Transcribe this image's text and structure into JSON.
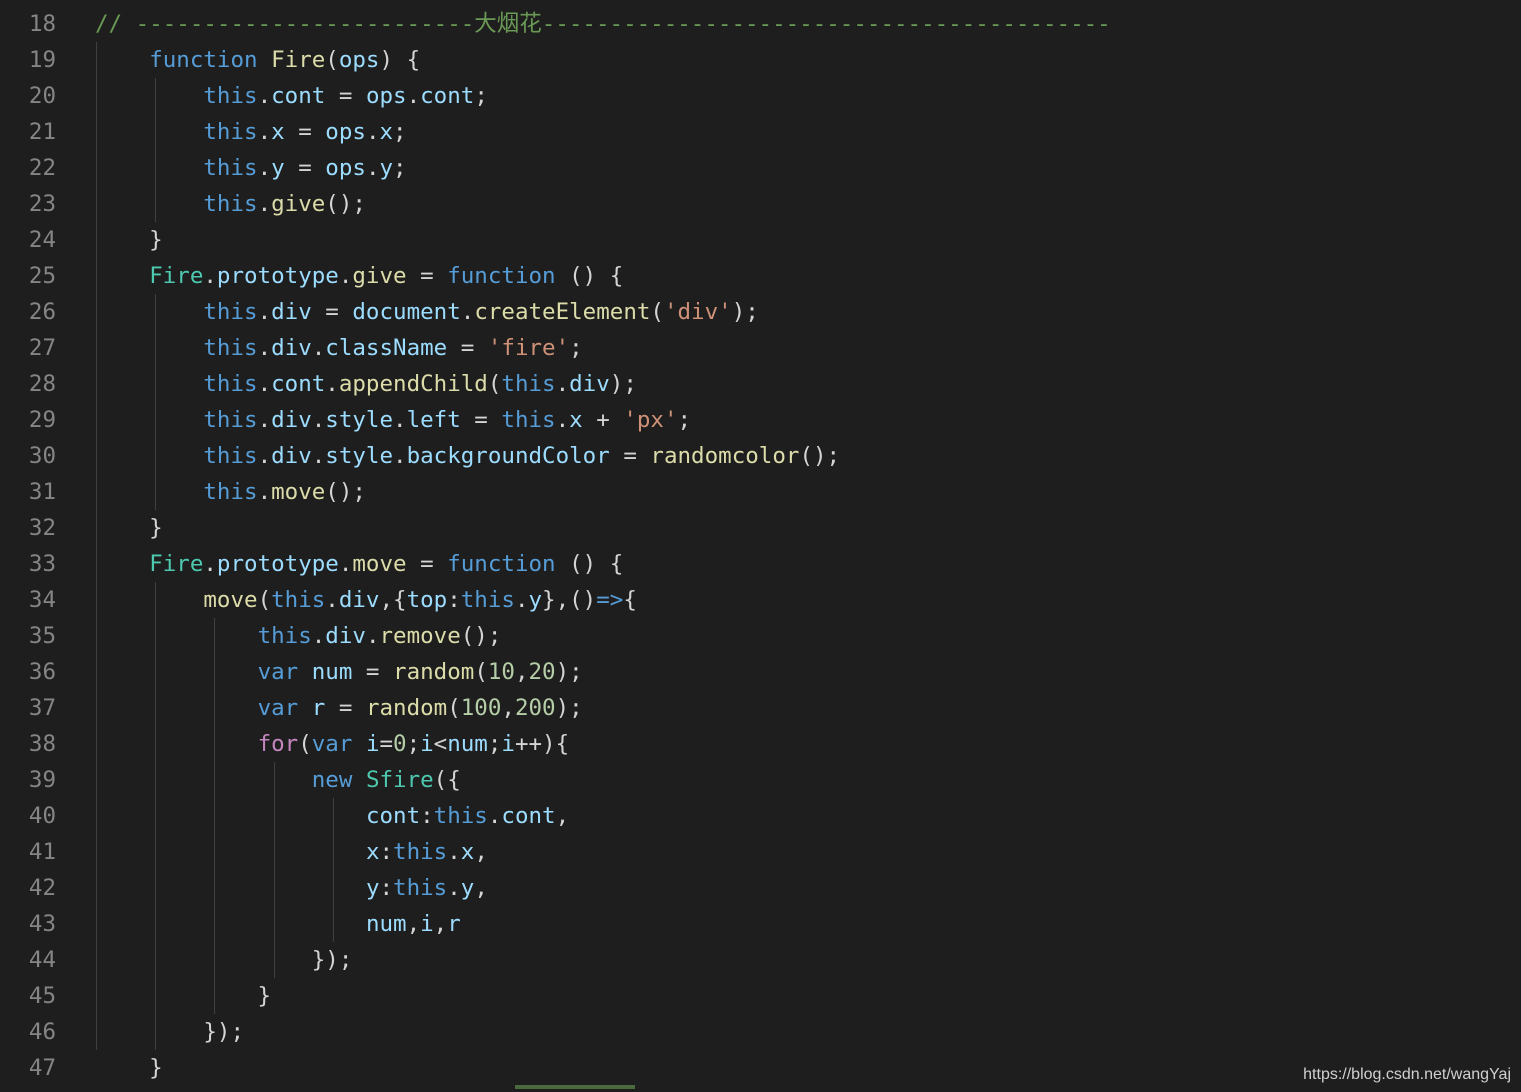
{
  "editor": {
    "watermark": "https://blog.csdn.net/wangYaj",
    "lines": [
      {
        "num": "18",
        "tokens": [
          {
            "t": "// -------------------------大烟花------------------------------------------",
            "c": "cmt"
          }
        ]
      },
      {
        "num": "19",
        "tokens": [
          {
            "t": "    "
          },
          {
            "t": "function",
            "c": "kw-blue"
          },
          {
            "t": " "
          },
          {
            "t": "Fire",
            "c": "fn"
          },
          {
            "t": "("
          },
          {
            "t": "ops",
            "c": "var"
          },
          {
            "t": ") {"
          }
        ]
      },
      {
        "num": "20",
        "tokens": [
          {
            "t": "        "
          },
          {
            "t": "this",
            "c": "kw-blue"
          },
          {
            "t": "."
          },
          {
            "t": "cont",
            "c": "var"
          },
          {
            "t": " = "
          },
          {
            "t": "ops",
            "c": "var"
          },
          {
            "t": "."
          },
          {
            "t": "cont",
            "c": "var"
          },
          {
            "t": ";"
          }
        ]
      },
      {
        "num": "21",
        "tokens": [
          {
            "t": "        "
          },
          {
            "t": "this",
            "c": "kw-blue"
          },
          {
            "t": "."
          },
          {
            "t": "x",
            "c": "var"
          },
          {
            "t": " = "
          },
          {
            "t": "ops",
            "c": "var"
          },
          {
            "t": "."
          },
          {
            "t": "x",
            "c": "var"
          },
          {
            "t": ";"
          }
        ]
      },
      {
        "num": "22",
        "tokens": [
          {
            "t": "        "
          },
          {
            "t": "this",
            "c": "kw-blue"
          },
          {
            "t": "."
          },
          {
            "t": "y",
            "c": "var"
          },
          {
            "t": " = "
          },
          {
            "t": "ops",
            "c": "var"
          },
          {
            "t": "."
          },
          {
            "t": "y",
            "c": "var"
          },
          {
            "t": ";"
          }
        ]
      },
      {
        "num": "23",
        "tokens": [
          {
            "t": "        "
          },
          {
            "t": "this",
            "c": "kw-blue"
          },
          {
            "t": "."
          },
          {
            "t": "give",
            "c": "fn"
          },
          {
            "t": "();"
          }
        ]
      },
      {
        "num": "24",
        "tokens": [
          {
            "t": "    }"
          }
        ]
      },
      {
        "num": "25",
        "tokens": [
          {
            "t": "    "
          },
          {
            "t": "Fire",
            "c": "type"
          },
          {
            "t": "."
          },
          {
            "t": "prototype",
            "c": "var"
          },
          {
            "t": "."
          },
          {
            "t": "give",
            "c": "fn"
          },
          {
            "t": " = "
          },
          {
            "t": "function",
            "c": "kw-blue"
          },
          {
            "t": " () {"
          }
        ]
      },
      {
        "num": "26",
        "tokens": [
          {
            "t": "        "
          },
          {
            "t": "this",
            "c": "kw-blue"
          },
          {
            "t": "."
          },
          {
            "t": "div",
            "c": "var"
          },
          {
            "t": " = "
          },
          {
            "t": "document",
            "c": "var"
          },
          {
            "t": "."
          },
          {
            "t": "createElement",
            "c": "fn"
          },
          {
            "t": "("
          },
          {
            "t": "'div'",
            "c": "str"
          },
          {
            "t": ");"
          }
        ]
      },
      {
        "num": "27",
        "tokens": [
          {
            "t": "        "
          },
          {
            "t": "this",
            "c": "kw-blue"
          },
          {
            "t": "."
          },
          {
            "t": "div",
            "c": "var"
          },
          {
            "t": "."
          },
          {
            "t": "className",
            "c": "var"
          },
          {
            "t": " = "
          },
          {
            "t": "'fire'",
            "c": "str"
          },
          {
            "t": ";"
          }
        ]
      },
      {
        "num": "28",
        "tokens": [
          {
            "t": "        "
          },
          {
            "t": "this",
            "c": "kw-blue"
          },
          {
            "t": "."
          },
          {
            "t": "cont",
            "c": "var"
          },
          {
            "t": "."
          },
          {
            "t": "appendChild",
            "c": "fn"
          },
          {
            "t": "("
          },
          {
            "t": "this",
            "c": "kw-blue"
          },
          {
            "t": "."
          },
          {
            "t": "div",
            "c": "var"
          },
          {
            "t": ");"
          }
        ]
      },
      {
        "num": "29",
        "tokens": [
          {
            "t": "        "
          },
          {
            "t": "this",
            "c": "kw-blue"
          },
          {
            "t": "."
          },
          {
            "t": "div",
            "c": "var"
          },
          {
            "t": "."
          },
          {
            "t": "style",
            "c": "var"
          },
          {
            "t": "."
          },
          {
            "t": "left",
            "c": "var"
          },
          {
            "t": " = "
          },
          {
            "t": "this",
            "c": "kw-blue"
          },
          {
            "t": "."
          },
          {
            "t": "x",
            "c": "var"
          },
          {
            "t": " + "
          },
          {
            "t": "'px'",
            "c": "str"
          },
          {
            "t": ";"
          }
        ]
      },
      {
        "num": "30",
        "tokens": [
          {
            "t": "        "
          },
          {
            "t": "this",
            "c": "kw-blue"
          },
          {
            "t": "."
          },
          {
            "t": "div",
            "c": "var"
          },
          {
            "t": "."
          },
          {
            "t": "style",
            "c": "var"
          },
          {
            "t": "."
          },
          {
            "t": "backgroundColor",
            "c": "var"
          },
          {
            "t": " = "
          },
          {
            "t": "randomcolor",
            "c": "fn"
          },
          {
            "t": "();"
          }
        ]
      },
      {
        "num": "31",
        "tokens": [
          {
            "t": "        "
          },
          {
            "t": "this",
            "c": "kw-blue"
          },
          {
            "t": "."
          },
          {
            "t": "move",
            "c": "fn"
          },
          {
            "t": "();"
          }
        ]
      },
      {
        "num": "32",
        "tokens": [
          {
            "t": "    }"
          }
        ]
      },
      {
        "num": "33",
        "tokens": [
          {
            "t": "    "
          },
          {
            "t": "Fire",
            "c": "type"
          },
          {
            "t": "."
          },
          {
            "t": "prototype",
            "c": "var"
          },
          {
            "t": "."
          },
          {
            "t": "move",
            "c": "fn"
          },
          {
            "t": " = "
          },
          {
            "t": "function",
            "c": "kw-blue"
          },
          {
            "t": " () {"
          }
        ]
      },
      {
        "num": "34",
        "tokens": [
          {
            "t": "        "
          },
          {
            "t": "move",
            "c": "fn"
          },
          {
            "t": "("
          },
          {
            "t": "this",
            "c": "kw-blue"
          },
          {
            "t": "."
          },
          {
            "t": "div",
            "c": "var"
          },
          {
            "t": ",{"
          },
          {
            "t": "top",
            "c": "var"
          },
          {
            "t": ":"
          },
          {
            "t": "this",
            "c": "kw-blue"
          },
          {
            "t": "."
          },
          {
            "t": "y",
            "c": "var"
          },
          {
            "t": "},()"
          },
          {
            "t": "=>",
            "c": "kw-blue"
          },
          {
            "t": "{"
          }
        ]
      },
      {
        "num": "35",
        "tokens": [
          {
            "t": "            "
          },
          {
            "t": "this",
            "c": "kw-blue"
          },
          {
            "t": "."
          },
          {
            "t": "div",
            "c": "var"
          },
          {
            "t": "."
          },
          {
            "t": "remove",
            "c": "fn"
          },
          {
            "t": "();"
          }
        ]
      },
      {
        "num": "36",
        "tokens": [
          {
            "t": "            "
          },
          {
            "t": "var",
            "c": "kw-blue"
          },
          {
            "t": " "
          },
          {
            "t": "num",
            "c": "var"
          },
          {
            "t": " = "
          },
          {
            "t": "random",
            "c": "fn"
          },
          {
            "t": "("
          },
          {
            "t": "10",
            "c": "num"
          },
          {
            "t": ","
          },
          {
            "t": "20",
            "c": "num"
          },
          {
            "t": ");"
          }
        ]
      },
      {
        "num": "37",
        "tokens": [
          {
            "t": "            "
          },
          {
            "t": "var",
            "c": "kw-blue"
          },
          {
            "t": " "
          },
          {
            "t": "r",
            "c": "var"
          },
          {
            "t": " = "
          },
          {
            "t": "random",
            "c": "fn"
          },
          {
            "t": "("
          },
          {
            "t": "100",
            "c": "num"
          },
          {
            "t": ","
          },
          {
            "t": "200",
            "c": "num"
          },
          {
            "t": ");"
          }
        ]
      },
      {
        "num": "38",
        "tokens": [
          {
            "t": "            "
          },
          {
            "t": "for",
            "c": "ctrl"
          },
          {
            "t": "("
          },
          {
            "t": "var",
            "c": "kw-blue"
          },
          {
            "t": " "
          },
          {
            "t": "i",
            "c": "var"
          },
          {
            "t": "="
          },
          {
            "t": "0",
            "c": "num"
          },
          {
            "t": ";"
          },
          {
            "t": "i",
            "c": "var"
          },
          {
            "t": "<"
          },
          {
            "t": "num",
            "c": "var"
          },
          {
            "t": ";"
          },
          {
            "t": "i",
            "c": "var"
          },
          {
            "t": "++){"
          }
        ]
      },
      {
        "num": "39",
        "tokens": [
          {
            "t": "                "
          },
          {
            "t": "new",
            "c": "kw-blue"
          },
          {
            "t": " "
          },
          {
            "t": "Sfire",
            "c": "type"
          },
          {
            "t": "({"
          }
        ]
      },
      {
        "num": "40",
        "tokens": [
          {
            "t": "                    "
          },
          {
            "t": "cont",
            "c": "var"
          },
          {
            "t": ":"
          },
          {
            "t": "this",
            "c": "kw-blue"
          },
          {
            "t": "."
          },
          {
            "t": "cont",
            "c": "var"
          },
          {
            "t": ","
          }
        ]
      },
      {
        "num": "41",
        "tokens": [
          {
            "t": "                    "
          },
          {
            "t": "x",
            "c": "var"
          },
          {
            "t": ":"
          },
          {
            "t": "this",
            "c": "kw-blue"
          },
          {
            "t": "."
          },
          {
            "t": "x",
            "c": "var"
          },
          {
            "t": ","
          }
        ]
      },
      {
        "num": "42",
        "tokens": [
          {
            "t": "                    "
          },
          {
            "t": "y",
            "c": "var"
          },
          {
            "t": ":"
          },
          {
            "t": "this",
            "c": "kw-blue"
          },
          {
            "t": "."
          },
          {
            "t": "y",
            "c": "var"
          },
          {
            "t": ","
          }
        ]
      },
      {
        "num": "43",
        "tokens": [
          {
            "t": "                    "
          },
          {
            "t": "num",
            "c": "var"
          },
          {
            "t": ","
          },
          {
            "t": "i",
            "c": "var"
          },
          {
            "t": ","
          },
          {
            "t": "r",
            "c": "var"
          }
        ]
      },
      {
        "num": "44",
        "tokens": [
          {
            "t": "                });"
          }
        ]
      },
      {
        "num": "45",
        "tokens": [
          {
            "t": "            }"
          }
        ]
      },
      {
        "num": "46",
        "tokens": [
          {
            "t": "        });"
          }
        ]
      },
      {
        "num": "47",
        "tokens": [
          {
            "t": "    }"
          }
        ]
      }
    ]
  }
}
